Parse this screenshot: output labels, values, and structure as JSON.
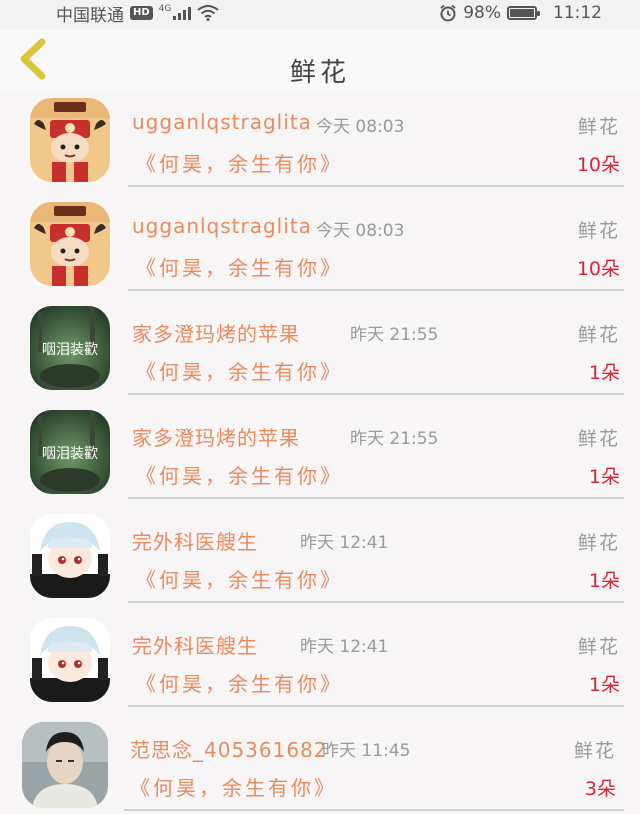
{
  "status_bar": {
    "carrier": "中国联通",
    "hd_badge": "HD",
    "network": "4G",
    "battery_percent": "98%",
    "battery_level": 0.98,
    "time": "11:12"
  },
  "header": {
    "title": "鲜花",
    "back_icon": "chevron-left-icon"
  },
  "accent_colors": {
    "name_and_book": "#e98b5e",
    "count": "#d6263a",
    "back_chevron": "#d9c63a"
  },
  "items": [
    {
      "avatar": "taurus-cartoon",
      "name": "ugganlqstraglita",
      "time": "今天 08:03",
      "gift_type": "鲜花",
      "book": "《何昊，余生有你》",
      "count": "10朵"
    },
    {
      "avatar": "taurus-cartoon",
      "name": "ugganlqstraglita",
      "time": "今天 08:03",
      "gift_type": "鲜花",
      "book": "《何昊，余生有你》",
      "count": "10朵"
    },
    {
      "avatar": "forest-photo",
      "name": "家多澄玛烤的苹果",
      "time": "昨天 21:55",
      "gift_type": "鲜花",
      "book": "《何昊，余生有你》",
      "count": "1朵"
    },
    {
      "avatar": "forest-photo",
      "name": "家多澄玛烤的苹果",
      "time": "昨天 21:55",
      "gift_type": "鲜花",
      "book": "《何昊，余生有你》",
      "count": "1朵"
    },
    {
      "avatar": "anime-boy",
      "name": "完外科医艘生",
      "time": "昨天 12:41",
      "gift_type": "鲜花",
      "book": "《何昊，余生有你》",
      "count": "1朵"
    },
    {
      "avatar": "anime-boy",
      "name": "完外科医艘生",
      "time": "昨天 12:41",
      "gift_type": "鲜花",
      "book": "《何昊，余生有你》",
      "count": "1朵"
    },
    {
      "avatar": "man-portrait",
      "name": "范思念_405361682",
      "time": "昨天 11:45",
      "gift_type": "鲜花",
      "book": "《何昊，余生有你》",
      "count": "3朵"
    }
  ]
}
